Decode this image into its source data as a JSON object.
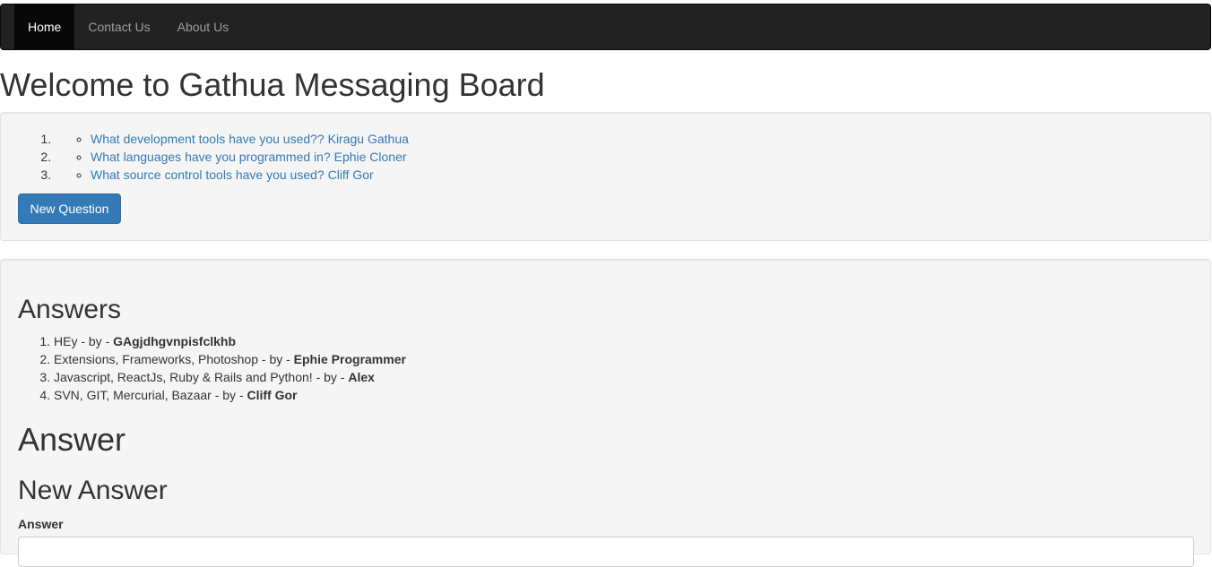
{
  "navbar": {
    "items": [
      {
        "label": "Home",
        "active": true
      },
      {
        "label": "Contact Us",
        "active": false
      },
      {
        "label": "About Us",
        "active": false
      }
    ]
  },
  "page": {
    "title": "Welcome to Gathua Messaging Board"
  },
  "questions": {
    "items": [
      {
        "text": "What development tools have you used?? Kiragu Gathua"
      },
      {
        "text": "What languages have you programmed in? Ephie Cloner"
      },
      {
        "text": "What source control tools have you used? Cliff Gor"
      }
    ],
    "new_button_label": "New Question"
  },
  "answers": {
    "heading": "Answers",
    "separator": " - by - ",
    "items": [
      {
        "text": "HEy",
        "author": "GAgjdhgvnpisfclkhb"
      },
      {
        "text": "Extensions, Frameworks, Photoshop",
        "author": "Ephie Programmer"
      },
      {
        "text": "Javascript, ReactJs, Ruby & Rails and Python!",
        "author": "Alex"
      },
      {
        "text": "SVN, GIT, Mercurial, Bazaar",
        "author": "Cliff Gor"
      }
    ],
    "answer_heading": "Answer",
    "new_answer_heading": "New Answer",
    "answer_field_label": "Answer",
    "answer_field_value": ""
  },
  "colors": {
    "navbar_bg": "#222222",
    "link": "#337ab7",
    "primary_button": "#337ab7",
    "well_bg": "#f5f5f5"
  }
}
